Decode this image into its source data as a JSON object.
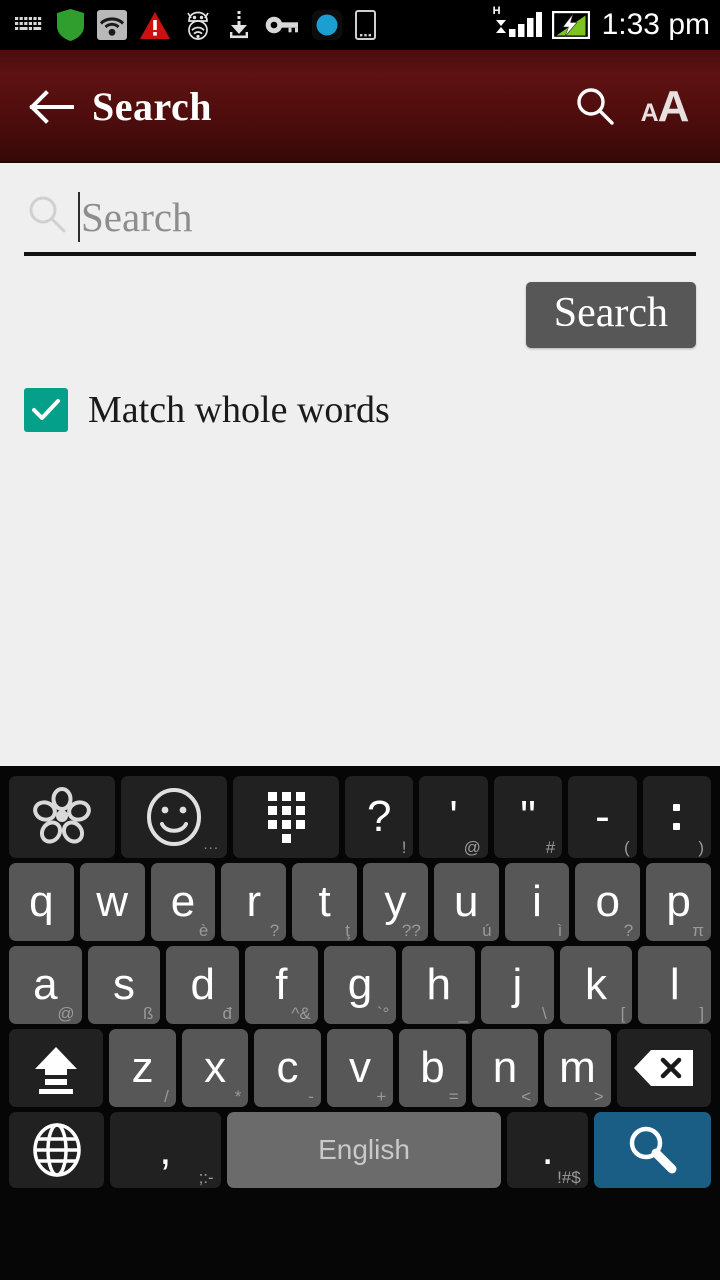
{
  "status_bar": {
    "time": "1:33 pm",
    "network_type": "H",
    "icons": [
      {
        "name": "keyboard-icon"
      },
      {
        "name": "shield-icon"
      },
      {
        "name": "wifi-icon"
      },
      {
        "name": "warning-icon"
      },
      {
        "name": "bug-droid-icon"
      },
      {
        "name": "download-icon"
      },
      {
        "name": "vpn-key-icon"
      },
      {
        "name": "circle-app-icon"
      },
      {
        "name": "phone-icon"
      }
    ],
    "signal_bars": 4,
    "battery": "charging"
  },
  "app_bar": {
    "title": "Search",
    "back_label": "Back",
    "search_label": "Search",
    "font_size_small": "A",
    "font_size_large": "A"
  },
  "search_panel": {
    "placeholder": "Search",
    "value": "",
    "button_label": "Search",
    "checkbox_label": "Match whole words",
    "checkbox_checked": true,
    "checkbox_color": "#04a08a"
  },
  "keyboard": {
    "language": "English",
    "enter_action": "search",
    "rows": [
      [
        {
          "main": "",
          "sub": "",
          "icon": "flower-icon",
          "type": "dark",
          "cls": "k-flower"
        },
        {
          "main": "",
          "sub": "",
          "icon": "smiley-icon",
          "type": "dark",
          "cls": "k-smiley"
        },
        {
          "main": "",
          "sub": "",
          "icon": "numeric-keypad-icon",
          "type": "dark",
          "cls": "k-num"
        },
        {
          "main": "?",
          "sub": "!",
          "type": "dark"
        },
        {
          "main": "'",
          "sub": "@",
          "type": "dark"
        },
        {
          "main": "\"",
          "sub": "#",
          "type": "dark"
        },
        {
          "main": "-",
          "sub": "(",
          "type": "dark"
        },
        {
          "main": "",
          "sub": ")",
          "icon": "vertical-dots-icon",
          "type": "dark"
        }
      ],
      [
        {
          "main": "q",
          "sub": ""
        },
        {
          "main": "w",
          "sub": ""
        },
        {
          "main": "e",
          "sub": "è"
        },
        {
          "main": "r",
          "sub": "?"
        },
        {
          "main": "t",
          "sub": "ţ"
        },
        {
          "main": "y",
          "sub": "??"
        },
        {
          "main": "u",
          "sub": "ú"
        },
        {
          "main": "i",
          "sub": "ì"
        },
        {
          "main": "o",
          "sub": "?"
        },
        {
          "main": "p",
          "sub": "π"
        }
      ],
      [
        {
          "main": "a",
          "sub": "@"
        },
        {
          "main": "s",
          "sub": "ß"
        },
        {
          "main": "d",
          "sub": "đ"
        },
        {
          "main": "f",
          "sub": "^&"
        },
        {
          "main": "g",
          "sub": "`°"
        },
        {
          "main": "h",
          "sub": "_"
        },
        {
          "main": "j",
          "sub": "\\"
        },
        {
          "main": "k",
          "sub": "["
        },
        {
          "main": "l",
          "sub": "]"
        }
      ],
      [
        {
          "main": "",
          "sub": "",
          "icon": "shift-icon",
          "type": "dark",
          "cls": "k-shift"
        },
        {
          "main": "z",
          "sub": "/"
        },
        {
          "main": "x",
          "sub": "*"
        },
        {
          "main": "c",
          "sub": "-"
        },
        {
          "main": "v",
          "sub": "+"
        },
        {
          "main": "b",
          "sub": "="
        },
        {
          "main": "n",
          "sub": "<"
        },
        {
          "main": "m",
          "sub": ">"
        },
        {
          "main": "",
          "sub": "",
          "icon": "backspace-icon",
          "type": "dark",
          "cls": "k-bksp"
        }
      ],
      [
        {
          "main": "",
          "sub": "",
          "icon": "globe-icon",
          "type": "dark",
          "cls": "k-globe"
        },
        {
          "main": ",",
          "sub": ";:-",
          "type": "dark",
          "cls": "k-comma"
        },
        {
          "main": "English",
          "sub": "",
          "type": "space",
          "cls": "k-space"
        },
        {
          "main": ".",
          "sub": "!#$",
          "type": "dark",
          "cls": "k-period"
        },
        {
          "main": "",
          "sub": "",
          "icon": "search-icon",
          "type": "enter",
          "cls": "k-enter"
        }
      ]
    ]
  }
}
